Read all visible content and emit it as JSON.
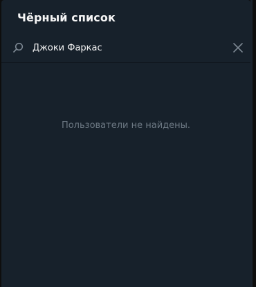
{
  "dialog": {
    "title": "Чёрный список"
  },
  "search": {
    "value": "Джоки Фаркас",
    "icon": "search-icon",
    "clear_icon": "close-icon"
  },
  "results": {
    "empty_message": "Пользователи не найдены."
  },
  "colors": {
    "background": "#17212b",
    "text_primary": "#f5f5f5",
    "text_secondary": "#6c7883",
    "icon": "#7c8792"
  }
}
